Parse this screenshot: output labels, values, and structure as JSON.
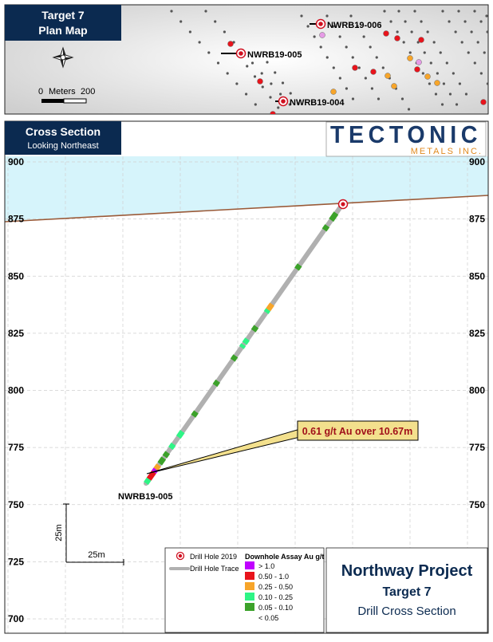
{
  "plan_map": {
    "title_line1": "Target 7",
    "title_line2": "Plan Map",
    "scale_zero": "0",
    "scale_label": "Meters",
    "scale_max": "200",
    "holes": [
      {
        "label": "NWRB19-006"
      },
      {
        "label": "NWRB19-005"
      },
      {
        "label": "NWRB19-004"
      }
    ]
  },
  "cross_section": {
    "title": "Cross Section",
    "subtitle": "Looking Northeast",
    "logo_main": "TECTONIC",
    "logo_sub": "METALS INC.",
    "elevation_ticks": [
      "900",
      "875",
      "850",
      "825",
      "800",
      "775",
      "750",
      "725",
      "700"
    ],
    "hole_label": "NWRB19-005",
    "callout": "0.61 g/t Au over 10.67m",
    "scale_vertical": "25m",
    "scale_horizontal": "25m"
  },
  "legend": {
    "drill_hole": "Drill Hole 2019",
    "drill_trace": "Drill Hole Trace",
    "assay_title": "Downhole Assay Au g/t",
    "assay_classes": [
      {
        "label": "> 1.0",
        "color": "#c000ff"
      },
      {
        "label": "0.50 - 1.0",
        "color": "#e8141c"
      },
      {
        "label": "0.25 - 0.50",
        "color": "#f7a52a"
      },
      {
        "label": "0.10 - 0.25",
        "color": "#2ef586"
      },
      {
        "label": "0.05 - 0.10",
        "color": "#3ca22a"
      },
      {
        "label": "< 0.05",
        "color": ""
      }
    ]
  },
  "project_box": {
    "title": "Northway Project",
    "subtitle": "Target 7",
    "description": "Drill Cross Section"
  },
  "colors": {
    "header_navy": "#0b2a50",
    "sky": "#d6f4fb",
    "ground_line": "#9a5a38",
    "trace": "#b0b0b0",
    "callout_fill": "#f3e08d",
    "callout_text": "#a0101a"
  }
}
